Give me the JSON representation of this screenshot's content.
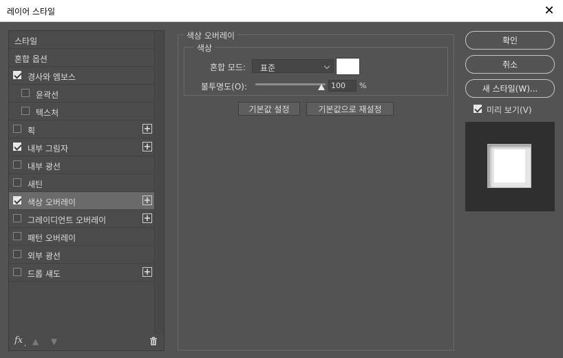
{
  "window": {
    "title": "레이어 스타일",
    "close_icon": "close-icon"
  },
  "left": {
    "items": [
      {
        "label": "스타일",
        "checkbox": false,
        "checked": false,
        "sub": false,
        "plus": false,
        "selected": false
      },
      {
        "label": "혼합 옵션",
        "checkbox": false,
        "checked": false,
        "sub": false,
        "plus": false,
        "selected": false
      },
      {
        "label": "경사와 엠보스",
        "checkbox": true,
        "checked": true,
        "sub": false,
        "plus": false,
        "selected": false
      },
      {
        "label": "윤곽선",
        "checkbox": true,
        "checked": false,
        "sub": true,
        "plus": false,
        "selected": false
      },
      {
        "label": "텍스처",
        "checkbox": true,
        "checked": false,
        "sub": true,
        "plus": false,
        "selected": false
      },
      {
        "label": "획",
        "checkbox": true,
        "checked": false,
        "sub": false,
        "plus": true,
        "selected": false
      },
      {
        "label": "내부 그림자",
        "checkbox": true,
        "checked": true,
        "sub": false,
        "plus": true,
        "selected": false
      },
      {
        "label": "내부 광선",
        "checkbox": true,
        "checked": false,
        "sub": false,
        "plus": false,
        "selected": false
      },
      {
        "label": "새틴",
        "checkbox": true,
        "checked": false,
        "sub": false,
        "plus": false,
        "selected": false
      },
      {
        "label": "색상 오버레이",
        "checkbox": true,
        "checked": true,
        "sub": false,
        "plus": true,
        "selected": true
      },
      {
        "label": "그레이디언트 오버레이",
        "checkbox": true,
        "checked": false,
        "sub": false,
        "plus": true,
        "selected": false
      },
      {
        "label": "패턴 오버레이",
        "checkbox": true,
        "checked": false,
        "sub": false,
        "plus": false,
        "selected": false
      },
      {
        "label": "외부 광선",
        "checkbox": true,
        "checked": false,
        "sub": false,
        "plus": false,
        "selected": false
      },
      {
        "label": "드롭 섀도",
        "checkbox": true,
        "checked": false,
        "sub": false,
        "plus": true,
        "selected": false
      }
    ],
    "bottom": {
      "fx": "fx",
      "fx_sub": ","
    }
  },
  "panel": {
    "group_title": "색상 오버레이",
    "sub_group_title": "색상",
    "blend_mode_label": "혼합 모드:",
    "blend_mode_value": "표준",
    "overlay_color": "#ffffff",
    "opacity_label": "불투명도(O):",
    "opacity_value": "100",
    "opacity_unit": "%",
    "opacity_fraction": 1.0,
    "btn_make_default": "기본값 설정",
    "btn_reset_default": "기본값으로 재설정"
  },
  "right": {
    "ok": "확인",
    "cancel": "취소",
    "new_style": "새 스타일(W)...",
    "preview_label": "미리 보기(V)",
    "preview_checked": true
  }
}
